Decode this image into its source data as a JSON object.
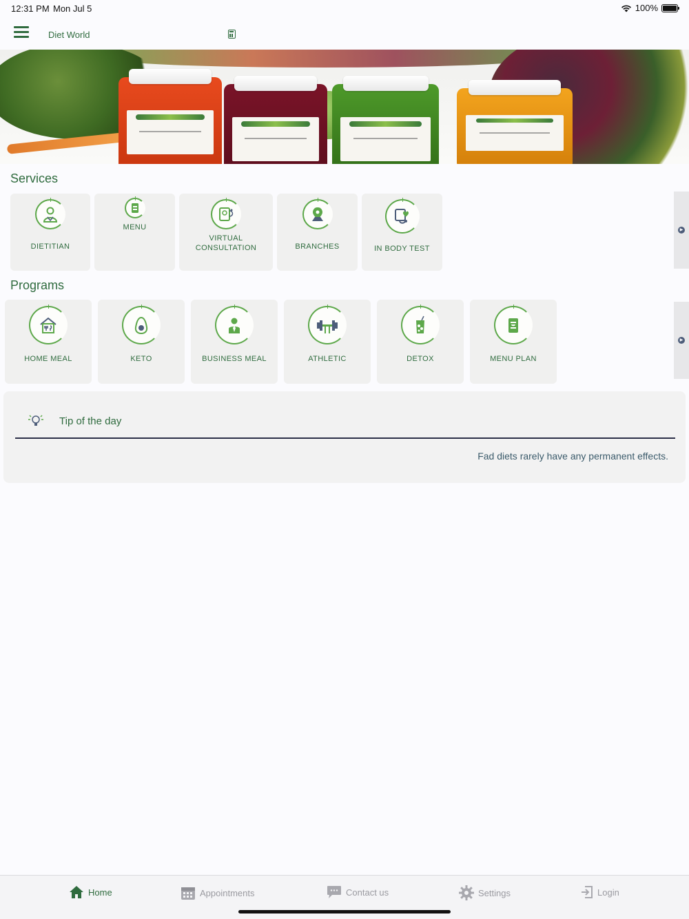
{
  "status_bar": {
    "time": "12:31 PM",
    "date": "Mon Jul 5",
    "battery": "100%"
  },
  "nav": {
    "title": "Diet World"
  },
  "hero": {
    "description_icons": [
      "jar",
      "jar",
      "jar",
      "jar"
    ]
  },
  "services": {
    "title": "Services",
    "items": [
      {
        "label": "DIETITIAN",
        "icon": "dietitian-icon"
      },
      {
        "label": "MENU",
        "icon": "menu-icon"
      },
      {
        "label": "VIRTUAL CONSULTATION",
        "icon": "virtual-consultation-icon"
      },
      {
        "label": "BRANCHES",
        "icon": "map-pin-icon"
      },
      {
        "label": "IN BODY TEST",
        "icon": "blood-pressure-icon"
      }
    ]
  },
  "programs": {
    "title": "Programs",
    "items": [
      {
        "label": "HOME MEAL",
        "icon": "home-meal-icon"
      },
      {
        "label": "KETO",
        "icon": "avocado-icon"
      },
      {
        "label": "BUSINESS MEAL",
        "icon": "business-person-icon"
      },
      {
        "label": "ATHLETIC",
        "icon": "dumbbell-icon"
      },
      {
        "label": "DETOX",
        "icon": "detox-juice-icon"
      },
      {
        "label": "MENU PLAN",
        "icon": "menu-plan-icon"
      }
    ]
  },
  "tip": {
    "title": "Tip of the day",
    "text": "Fad diets rarely have any permanent effects."
  },
  "tabs": [
    {
      "label": "Home",
      "icon": "home-icon",
      "active": true
    },
    {
      "label": "Appointments",
      "icon": "calendar-icon",
      "active": false
    },
    {
      "label": "Contact us",
      "icon": "chat-bubble-icon",
      "active": false
    },
    {
      "label": "Settings",
      "icon": "gear-icon",
      "active": false
    },
    {
      "label": "Login",
      "icon": "login-icon",
      "active": false
    }
  ],
  "colors": {
    "brand_green": "#2f6b3e",
    "icon_green": "#5da84a",
    "card_bg": "#f0f0ef",
    "inactive_tab": "#9a9aa0"
  }
}
